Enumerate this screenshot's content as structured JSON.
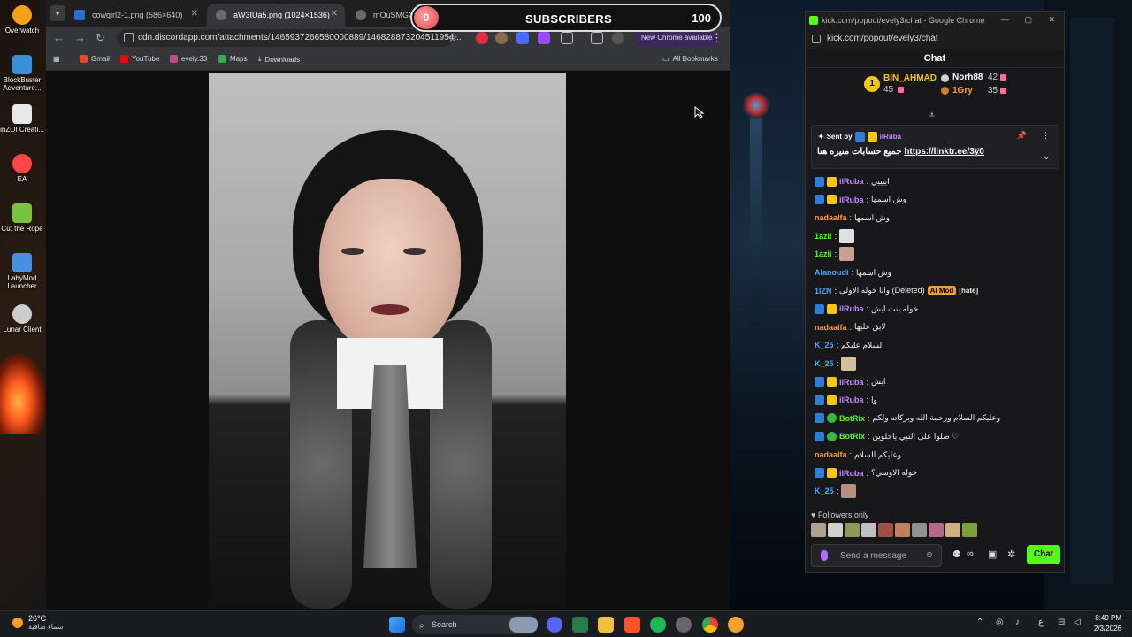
{
  "desktop": {
    "icons": [
      {
        "label": "Overwatch",
        "color": "#f99e1a"
      },
      {
        "label": "BlockBuster Adventure...",
        "color": "#3a8fd8"
      },
      {
        "label": "inZOI Creati...",
        "color": "#e8e8e8"
      },
      {
        "label": "EA",
        "color": "#ff4747"
      },
      {
        "label": "Cut the Rope",
        "color": "#7bc142"
      },
      {
        "label": "LabyMod Launcher",
        "color": "#4a90e2"
      },
      {
        "label": "Lunar Client",
        "color": "#cccccc"
      }
    ]
  },
  "browser": {
    "tabs": [
      {
        "title": "cowgirl2-1.png (586×640)",
        "active": false
      },
      {
        "title": "aW3IUa5.png (1024×1536)",
        "active": true
      },
      {
        "title": "mOuSMGX.p",
        "active": false
      }
    ],
    "address": "cdn.discordapp.com/attachments/1465937266580000889/146828873204511954...",
    "new_chrome_label": "New Chrome available",
    "bookmarks": [
      {
        "label": "Gmail",
        "color": "#ea4335"
      },
      {
        "label": "YouTube",
        "color": "#ff0000"
      },
      {
        "label": "evely.33",
        "color": "#c04a8a"
      },
      {
        "label": "Maps",
        "color": "#34a853"
      },
      {
        "label": "Downloads",
        "color": "#cccccc"
      }
    ],
    "all_bookmarks": "All Bookmarks"
  },
  "overlay": {
    "current": "0",
    "label": "SUBSCRIBERS",
    "goal": "100"
  },
  "chat_window": {
    "window_title": "kick.com/popout/evely3/chat - Google Chrome",
    "url": "kick.com/popout/evely3/chat",
    "header": "Chat",
    "leaderboard": {
      "first": {
        "rank": "1",
        "name": "BIN_AHMAD",
        "count": "45"
      },
      "second": {
        "name": "Norh88",
        "count": "42"
      },
      "third": {
        "name": "1Gry",
        "count": "35"
      }
    },
    "pinned": {
      "sent_by": "Sent by",
      "user": "ilRuba",
      "text": "جميع حسابات منيره هنا",
      "link": "https://linktr.ee/3y0"
    },
    "messages": [
      {
        "user": "ilRuba",
        "color": "#c58aff",
        "badges": [
          "blue",
          "crown"
        ],
        "text": "اييييي"
      },
      {
        "user": "ilRuba",
        "color": "#c58aff",
        "badges": [
          "blue",
          "crown"
        ],
        "text": "وش اسمها"
      },
      {
        "user": "nadaalfa",
        "color": "#ff9a3c",
        "badges": [],
        "text": "وش اسمها"
      },
      {
        "user": "1azii",
        "color": "#53fc18",
        "badges": [],
        "text": "",
        "emote": true
      },
      {
        "user": "1azii",
        "color": "#53fc18",
        "badges": [],
        "text": "",
        "emote": true
      },
      {
        "user": "Alanoudi",
        "color": "#4aa8ff",
        "badges": [],
        "text": "وش اسمها"
      },
      {
        "user": "1lZN",
        "color": "#4aa8ff",
        "badges": [],
        "text": "وانا خوله الاولى (Deleted)",
        "tag": "AI Mod",
        "tag2": "[hate]"
      },
      {
        "user": "ilRuba",
        "color": "#c58aff",
        "badges": [
          "blue",
          "crown"
        ],
        "text": "خوله بنت ايش"
      },
      {
        "user": "nadaalfa",
        "color": "#ff9a3c",
        "badges": [],
        "text": "لايق عليها"
      },
      {
        "user": "K_25",
        "color": "#4aa8ff",
        "badges": [],
        "text": "السلام عليكم"
      },
      {
        "user": "K_25",
        "color": "#4aa8ff",
        "badges": [],
        "text": "",
        "emote": true
      },
      {
        "user": "ilRuba",
        "color": "#c58aff",
        "badges": [
          "blue",
          "crown"
        ],
        "text": "ايش"
      },
      {
        "user": "ilRuba",
        "color": "#c58aff",
        "badges": [
          "blue",
          "crown"
        ],
        "text": "وا"
      },
      {
        "user": "BotRix",
        "color": "#53fc18",
        "badges": [
          "blue",
          "ok"
        ],
        "text": "وعليكم السلام ورحمة الله وبركاته ولكم"
      },
      {
        "user": "BotRix",
        "color": "#53fc18",
        "badges": [
          "blue",
          "ok"
        ],
        "text": "صلوا على النبي ياحلوين ♡"
      },
      {
        "user": "nadaalfa",
        "color": "#ff9a3c",
        "badges": [],
        "text": "وعليكم السلام"
      },
      {
        "user": "ilRuba",
        "color": "#c58aff",
        "badges": [
          "blue",
          "crown"
        ],
        "text": "خوله الاوسي؟"
      },
      {
        "user": "K_25",
        "color": "#4aa8ff",
        "badges": [],
        "text": "",
        "emote": true
      }
    ],
    "followers_only": "Followers only",
    "input_placeholder": "Send a message",
    "chat_button": "Chat"
  },
  "taskbar": {
    "temperature": "26°C",
    "weather_text": "سماء صافية",
    "search_label": "Search",
    "time": "8:49 PM",
    "date": "2/3/2026",
    "lang": "ع"
  }
}
